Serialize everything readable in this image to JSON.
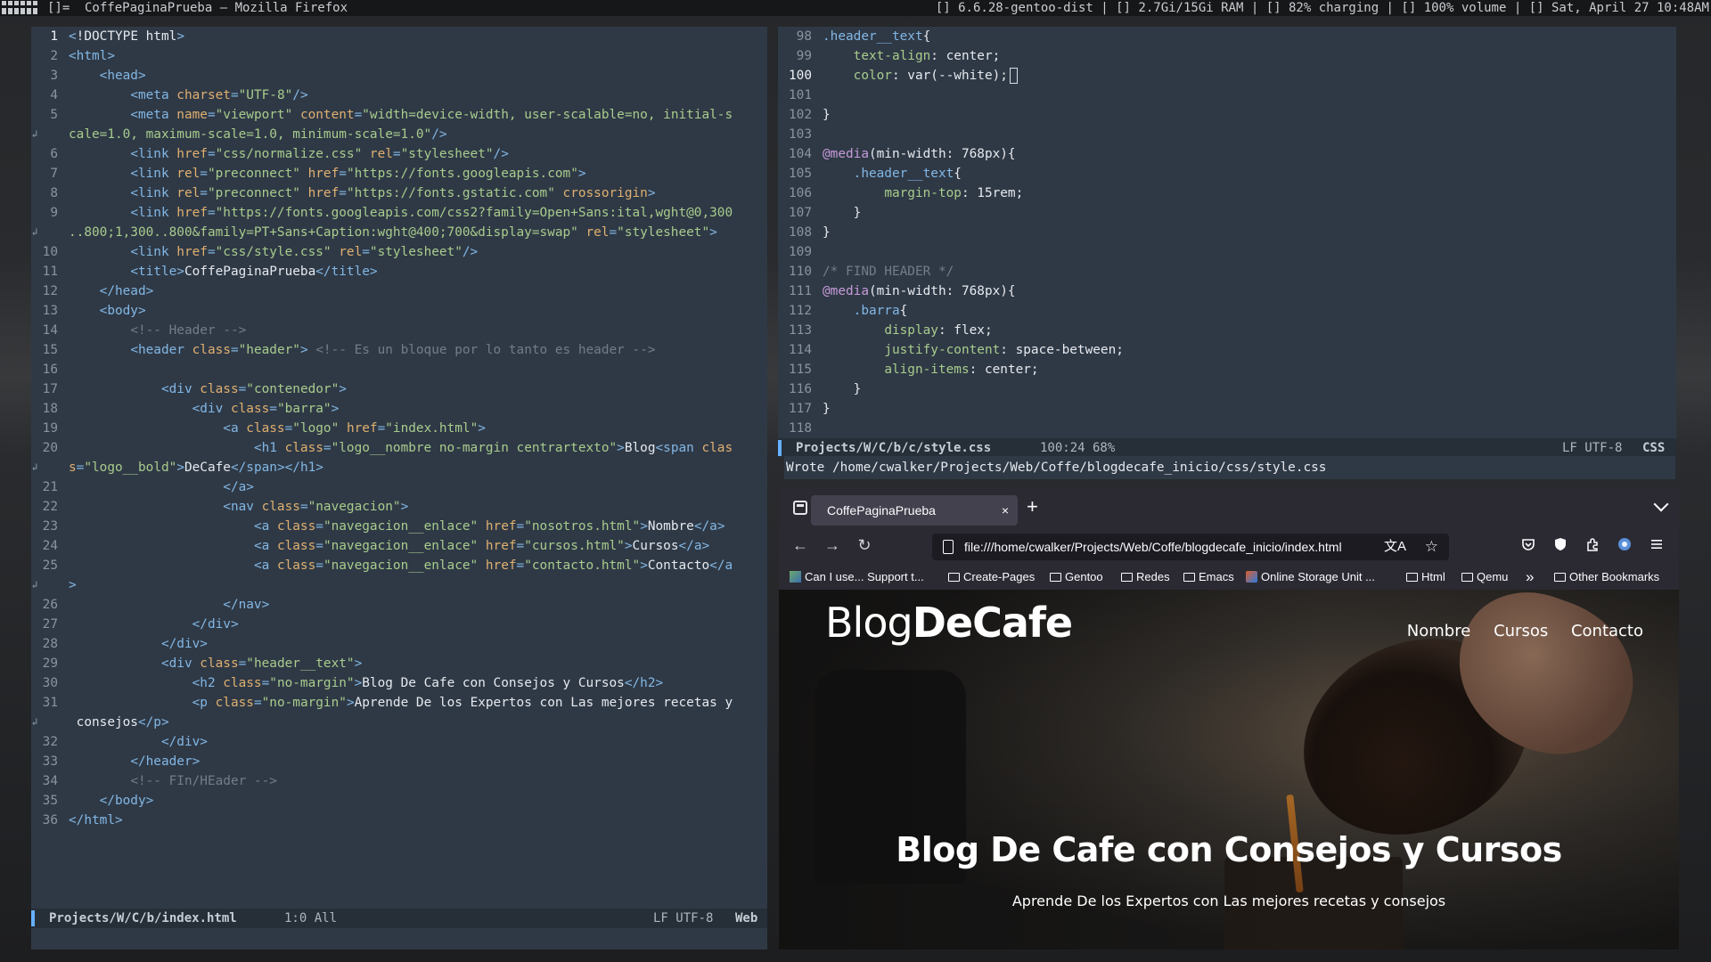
{
  "topbar": {
    "layout": "[]=",
    "window_title": "CoffePaginaPrueba — Mozilla Firefox",
    "status": "[] 6.6.28-gentoo-dist  |  [] 2.7Gi/15Gi RAM  |  [] 82% charging |  [] 100% volume  |  [] Sat, April 27 10:48AM"
  },
  "left_editor": {
    "modeline": {
      "file": "Projects/W/C/b/index.html",
      "pos": "1:0 All",
      "enc": "LF UTF-8",
      "mode": "Web"
    }
  },
  "right_editor": {
    "modeline": {
      "file": "Projects/W/C/b/c/style.css",
      "pos": "100:24 68%",
      "enc": "LF UTF-8",
      "mode": "CSS"
    },
    "echo": "Wrote /home/cwalker/Projects/Web/Coffe/blogdecafe_inicio/css/style.css"
  },
  "browser": {
    "tab_title": "CoffePaginaPrueba",
    "tab_close": "×",
    "new_tab": "+",
    "back": "←",
    "forward": "→",
    "reload": "↻",
    "url": "file:///home/cwalker/Projects/Web/Coffe/blogdecafe_inicio/index.html",
    "translate_icon": "文A",
    "star_icon": "☆",
    "bookmarks": [
      "Can I use... Support t...",
      "Create-Pages",
      "Gentoo",
      "Redes",
      "Emacs",
      "Online Storage Unit ...",
      "Html",
      "Qemu",
      "»",
      "Other Bookmarks"
    ],
    "page": {
      "logo_light": "Blog",
      "logo_bold": "DeCafe",
      "nav": [
        "Nombre",
        "Cursos",
        "Contacto"
      ],
      "heading": "Blog De Cafe con Consejos y Cursos",
      "subheading": "Aprende De los Expertos con Las mejores recetas y consejos"
    }
  },
  "html_lines": [
    {
      "n": "1",
      "cur": true,
      "parts": [
        [
          "tag",
          "<"
        ],
        [
          "txt",
          "!DOCTYPE html"
        ],
        [
          "tag",
          ">"
        ]
      ]
    },
    {
      "n": "2",
      "parts": [
        [
          "tag",
          "<html>"
        ]
      ]
    },
    {
      "n": "3",
      "parts": [
        [
          "txt",
          "    "
        ],
        [
          "tag",
          "<head>"
        ]
      ]
    },
    {
      "n": "4",
      "parts": [
        [
          "txt",
          "        "
        ],
        [
          "tag",
          "<meta "
        ],
        [
          "attr",
          "charset"
        ],
        [
          "tag",
          "="
        ],
        [
          "str",
          "\"UTF-8\""
        ],
        [
          "tag",
          "/>"
        ]
      ]
    },
    {
      "n": "5",
      "parts": [
        [
          "txt",
          "        "
        ],
        [
          "tag",
          "<meta "
        ],
        [
          "attr",
          "name"
        ],
        [
          "tag",
          "="
        ],
        [
          "str",
          "\"viewport\" "
        ],
        [
          "attr",
          "content"
        ],
        [
          "tag",
          "="
        ],
        [
          "str",
          "\"width=device-width, user-scalable=no, initial-s"
        ]
      ]
    },
    {
      "n": "",
      "fringe": true,
      "parts": [
        [
          "str",
          "cale=1.0, maximum-scale=1.0, minimum-scale=1.0\""
        ],
        [
          "tag",
          "/>"
        ]
      ]
    },
    {
      "n": "6",
      "parts": [
        [
          "txt",
          "        "
        ],
        [
          "tag",
          "<link "
        ],
        [
          "attr",
          "href"
        ],
        [
          "tag",
          "="
        ],
        [
          "str",
          "\"css/normalize.css\" "
        ],
        [
          "attr",
          "rel"
        ],
        [
          "tag",
          "="
        ],
        [
          "str",
          "\"stylesheet\""
        ],
        [
          "tag",
          "/>"
        ]
      ]
    },
    {
      "n": "7",
      "parts": [
        [
          "txt",
          "        "
        ],
        [
          "tag",
          "<link "
        ],
        [
          "attr",
          "rel"
        ],
        [
          "tag",
          "="
        ],
        [
          "str",
          "\"preconnect\" "
        ],
        [
          "attr",
          "href"
        ],
        [
          "tag",
          "="
        ],
        [
          "str",
          "\"https://fonts.googleapis.com\""
        ],
        [
          "tag",
          ">"
        ]
      ]
    },
    {
      "n": "8",
      "parts": [
        [
          "txt",
          "        "
        ],
        [
          "tag",
          "<link "
        ],
        [
          "attr",
          "rel"
        ],
        [
          "tag",
          "="
        ],
        [
          "str",
          "\"preconnect\" "
        ],
        [
          "attr",
          "href"
        ],
        [
          "tag",
          "="
        ],
        [
          "str",
          "\"https://fonts.gstatic.com\" "
        ],
        [
          "attr",
          "crossorigin"
        ],
        [
          "tag",
          ">"
        ]
      ]
    },
    {
      "n": "9",
      "parts": [
        [
          "txt",
          "        "
        ],
        [
          "tag",
          "<link "
        ],
        [
          "attr",
          "href"
        ],
        [
          "tag",
          "="
        ],
        [
          "str",
          "\"https://fonts.googleapis.com/css2?family=Open+Sans:ital,wght@0,300"
        ]
      ]
    },
    {
      "n": "",
      "fringe": true,
      "parts": [
        [
          "str",
          "..800;1,300..800&family=PT+Sans+Caption:wght@400;700&display=swap\" "
        ],
        [
          "attr",
          "rel"
        ],
        [
          "tag",
          "="
        ],
        [
          "str",
          "\"stylesheet\""
        ],
        [
          "tag",
          ">"
        ]
      ]
    },
    {
      "n": "10",
      "parts": [
        [
          "txt",
          "        "
        ],
        [
          "tag",
          "<link "
        ],
        [
          "attr",
          "href"
        ],
        [
          "tag",
          "="
        ],
        [
          "str",
          "\"css/style.css\" "
        ],
        [
          "attr",
          "rel"
        ],
        [
          "tag",
          "="
        ],
        [
          "str",
          "\"stylesheet\""
        ],
        [
          "tag",
          "/>"
        ]
      ]
    },
    {
      "n": "11",
      "parts": [
        [
          "txt",
          "        "
        ],
        [
          "tag",
          "<title>"
        ],
        [
          "txt",
          "CoffePaginaPrueba"
        ],
        [
          "tag",
          "</title>"
        ]
      ]
    },
    {
      "n": "12",
      "parts": [
        [
          "txt",
          "    "
        ],
        [
          "tag",
          "</head>"
        ]
      ]
    },
    {
      "n": "13",
      "parts": [
        [
          "txt",
          "    "
        ],
        [
          "tag",
          "<body>"
        ]
      ]
    },
    {
      "n": "14",
      "parts": [
        [
          "txt",
          "        "
        ],
        [
          "cmt",
          "<!-- Header -->"
        ]
      ]
    },
    {
      "n": "15",
      "parts": [
        [
          "txt",
          "        "
        ],
        [
          "tag",
          "<header "
        ],
        [
          "attr",
          "class"
        ],
        [
          "tag",
          "="
        ],
        [
          "str",
          "\"header\""
        ],
        [
          "tag",
          "> "
        ],
        [
          "cmt",
          "<!-- Es un bloque por lo tanto es header -->"
        ]
      ]
    },
    {
      "n": "16",
      "parts": []
    },
    {
      "n": "17",
      "parts": [
        [
          "txt",
          "            "
        ],
        [
          "tag",
          "<div "
        ],
        [
          "attr",
          "class"
        ],
        [
          "tag",
          "="
        ],
        [
          "str",
          "\"contenedor\""
        ],
        [
          "tag",
          ">"
        ]
      ]
    },
    {
      "n": "18",
      "parts": [
        [
          "txt",
          "                "
        ],
        [
          "tag",
          "<div "
        ],
        [
          "attr",
          "class"
        ],
        [
          "tag",
          "="
        ],
        [
          "str",
          "\"barra\""
        ],
        [
          "tag",
          ">"
        ]
      ]
    },
    {
      "n": "19",
      "parts": [
        [
          "txt",
          "                    "
        ],
        [
          "tag",
          "<a "
        ],
        [
          "attr",
          "class"
        ],
        [
          "tag",
          "="
        ],
        [
          "str",
          "\"logo\" "
        ],
        [
          "attr",
          "href"
        ],
        [
          "tag",
          "="
        ],
        [
          "str",
          "\"index.html\""
        ],
        [
          "tag",
          ">"
        ]
      ]
    },
    {
      "n": "20",
      "parts": [
        [
          "txt",
          "                        "
        ],
        [
          "tag",
          "<h1 "
        ],
        [
          "attr",
          "class"
        ],
        [
          "tag",
          "="
        ],
        [
          "str",
          "\"logo__nombre no-margin centrartexto\""
        ],
        [
          "tag",
          ">"
        ],
        [
          "txt",
          "Blog"
        ],
        [
          "tag",
          "<span "
        ],
        [
          "attr",
          "clas"
        ]
      ]
    },
    {
      "n": "",
      "fringe": true,
      "parts": [
        [
          "attr",
          "s"
        ],
        [
          "tag",
          "="
        ],
        [
          "str",
          "\"logo__bold\""
        ],
        [
          "tag",
          ">"
        ],
        [
          "txt",
          "DeCafe"
        ],
        [
          "tag",
          "</span></h1>"
        ]
      ]
    },
    {
      "n": "21",
      "parts": [
        [
          "txt",
          "                    "
        ],
        [
          "tag",
          "</a>"
        ]
      ]
    },
    {
      "n": "22",
      "parts": [
        [
          "txt",
          "                    "
        ],
        [
          "tag",
          "<nav "
        ],
        [
          "attr",
          "class"
        ],
        [
          "tag",
          "="
        ],
        [
          "str",
          "\"navegacion\""
        ],
        [
          "tag",
          ">"
        ]
      ]
    },
    {
      "n": "23",
      "parts": [
        [
          "txt",
          "                        "
        ],
        [
          "tag",
          "<a "
        ],
        [
          "attr",
          "class"
        ],
        [
          "tag",
          "="
        ],
        [
          "str",
          "\"navegacion__enlace\" "
        ],
        [
          "attr",
          "href"
        ],
        [
          "tag",
          "="
        ],
        [
          "str",
          "\"nosotros.html\""
        ],
        [
          "tag",
          ">"
        ],
        [
          "txt",
          "Nombre"
        ],
        [
          "tag",
          "</a>"
        ]
      ]
    },
    {
      "n": "24",
      "parts": [
        [
          "txt",
          "                        "
        ],
        [
          "tag",
          "<a "
        ],
        [
          "attr",
          "class"
        ],
        [
          "tag",
          "="
        ],
        [
          "str",
          "\"navegacion__enlace\" "
        ],
        [
          "attr",
          "href"
        ],
        [
          "tag",
          "="
        ],
        [
          "str",
          "\"cursos.html\""
        ],
        [
          "tag",
          ">"
        ],
        [
          "txt",
          "Cursos"
        ],
        [
          "tag",
          "</a>"
        ]
      ]
    },
    {
      "n": "25",
      "parts": [
        [
          "txt",
          "                        "
        ],
        [
          "tag",
          "<a "
        ],
        [
          "attr",
          "class"
        ],
        [
          "tag",
          "="
        ],
        [
          "str",
          "\"navegacion__enlace\" "
        ],
        [
          "attr",
          "href"
        ],
        [
          "tag",
          "="
        ],
        [
          "str",
          "\"contacto.html\""
        ],
        [
          "tag",
          ">"
        ],
        [
          "txt",
          "Contacto"
        ],
        [
          "tag",
          "</a"
        ]
      ]
    },
    {
      "n": "",
      "fringe": true,
      "parts": [
        [
          "tag",
          ">"
        ]
      ]
    },
    {
      "n": "26",
      "parts": [
        [
          "txt",
          "                    "
        ],
        [
          "tag",
          "</nav>"
        ]
      ]
    },
    {
      "n": "27",
      "parts": [
        [
          "txt",
          "                "
        ],
        [
          "tag",
          "</div>"
        ]
      ]
    },
    {
      "n": "28",
      "parts": [
        [
          "txt",
          "            "
        ],
        [
          "tag",
          "</div>"
        ]
      ]
    },
    {
      "n": "29",
      "parts": [
        [
          "txt",
          "            "
        ],
        [
          "tag",
          "<div "
        ],
        [
          "attr",
          "class"
        ],
        [
          "tag",
          "="
        ],
        [
          "str",
          "\"header__text\""
        ],
        [
          "tag",
          ">"
        ]
      ]
    },
    {
      "n": "30",
      "parts": [
        [
          "txt",
          "                "
        ],
        [
          "tag",
          "<h2 "
        ],
        [
          "attr",
          "class"
        ],
        [
          "tag",
          "="
        ],
        [
          "str",
          "\"no-margin\""
        ],
        [
          "tag",
          ">"
        ],
        [
          "txt",
          "Blog De Cafe con Consejos y Cursos"
        ],
        [
          "tag",
          "</h2>"
        ]
      ]
    },
    {
      "n": "31",
      "parts": [
        [
          "txt",
          "                "
        ],
        [
          "tag",
          "<p "
        ],
        [
          "attr",
          "class"
        ],
        [
          "tag",
          "="
        ],
        [
          "str",
          "\"no-margin\""
        ],
        [
          "tag",
          ">"
        ],
        [
          "txt",
          "Aprende De los Expertos con Las mejores recetas y"
        ]
      ]
    },
    {
      "n": "",
      "fringe": true,
      "parts": [
        [
          "txt",
          " consejos"
        ],
        [
          "tag",
          "</p>"
        ]
      ]
    },
    {
      "n": "32",
      "parts": [
        [
          "txt",
          "            "
        ],
        [
          "tag",
          "</div>"
        ]
      ]
    },
    {
      "n": "33",
      "parts": [
        [
          "txt",
          "        "
        ],
        [
          "tag",
          "</header>"
        ]
      ]
    },
    {
      "n": "34",
      "parts": [
        [
          "txt",
          "        "
        ],
        [
          "cmt",
          "<!-- FIn/HEader -->"
        ]
      ]
    },
    {
      "n": "35",
      "parts": [
        [
          "txt",
          "    "
        ],
        [
          "tag",
          "</body>"
        ]
      ]
    },
    {
      "n": "36",
      "parts": [
        [
          "tag",
          "</html>"
        ]
      ]
    }
  ],
  "css_lines": [
    {
      "n": "98",
      "parts": [
        [
          "sel",
          ".header__text"
        ],
        [
          "txt",
          "{"
        ]
      ]
    },
    {
      "n": "99",
      "parts": [
        [
          "txt",
          "    "
        ],
        [
          "prop",
          "text-align"
        ],
        [
          "txt",
          ": center;"
        ]
      ]
    },
    {
      "n": "100",
      "cur": true,
      "cursor": true,
      "parts": [
        [
          "txt",
          "    "
        ],
        [
          "prop",
          "color"
        ],
        [
          "txt",
          ": var(--white);"
        ]
      ]
    },
    {
      "n": "101",
      "parts": []
    },
    {
      "n": "102",
      "parts": [
        [
          "txt",
          "}"
        ]
      ]
    },
    {
      "n": "103",
      "parts": []
    },
    {
      "n": "104",
      "parts": [
        [
          "kw",
          "@media"
        ],
        [
          "txt",
          "(min-width: 768px){"
        ]
      ]
    },
    {
      "n": "105",
      "parts": [
        [
          "txt",
          "    "
        ],
        [
          "sel",
          ".header__text"
        ],
        [
          "txt",
          "{"
        ]
      ]
    },
    {
      "n": "106",
      "parts": [
        [
          "txt",
          "        "
        ],
        [
          "prop",
          "margin-top"
        ],
        [
          "txt",
          ": 15rem;"
        ]
      ]
    },
    {
      "n": "107",
      "parts": [
        [
          "txt",
          "    }"
        ]
      ]
    },
    {
      "n": "108",
      "parts": [
        [
          "txt",
          "}"
        ]
      ]
    },
    {
      "n": "109",
      "parts": []
    },
    {
      "n": "110",
      "parts": [
        [
          "cmt",
          "/* FIND HEADER */"
        ]
      ]
    },
    {
      "n": "111",
      "parts": [
        [
          "kw",
          "@media"
        ],
        [
          "txt",
          "(min-width: 768px){"
        ]
      ]
    },
    {
      "n": "112",
      "parts": [
        [
          "txt",
          "    "
        ],
        [
          "sel",
          ".barra"
        ],
        [
          "txt",
          "{"
        ]
      ]
    },
    {
      "n": "113",
      "parts": [
        [
          "txt",
          "        "
        ],
        [
          "prop",
          "display"
        ],
        [
          "txt",
          ": flex;"
        ]
      ]
    },
    {
      "n": "114",
      "parts": [
        [
          "txt",
          "        "
        ],
        [
          "prop",
          "justify-content"
        ],
        [
          "txt",
          ": space-between;"
        ]
      ]
    },
    {
      "n": "115",
      "parts": [
        [
          "txt",
          "        "
        ],
        [
          "prop",
          "align-items"
        ],
        [
          "txt",
          ": center;"
        ]
      ]
    },
    {
      "n": "116",
      "parts": [
        [
          "txt",
          "    }"
        ]
      ]
    },
    {
      "n": "117",
      "parts": [
        [
          "txt",
          "}"
        ]
      ]
    },
    {
      "n": "118",
      "parts": []
    }
  ]
}
